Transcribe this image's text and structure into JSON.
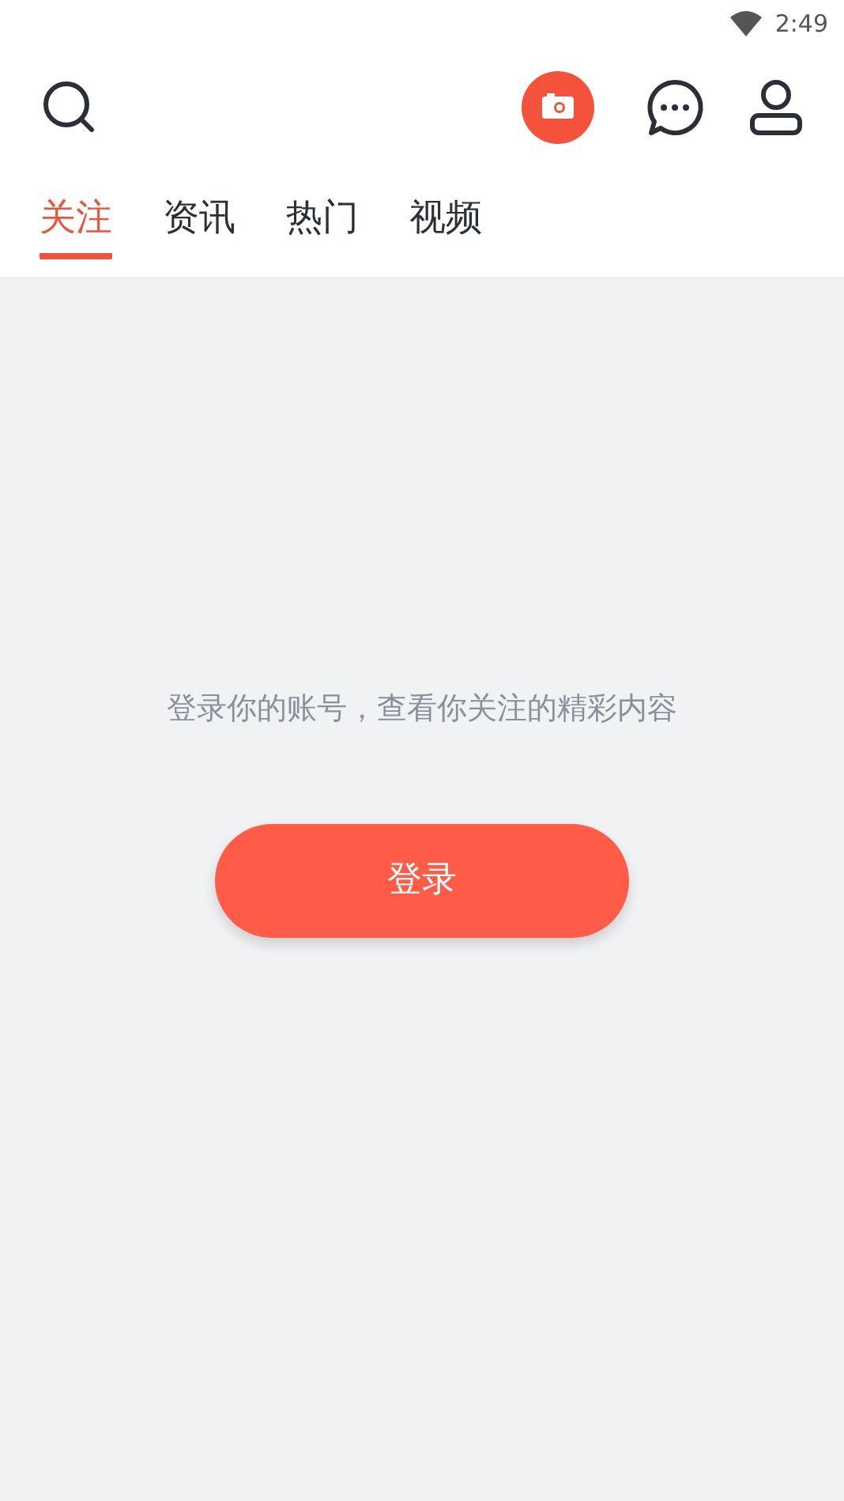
{
  "status_bar": {
    "time": "2:49"
  },
  "tabs": [
    {
      "label": "关注",
      "selected": true
    },
    {
      "label": "资讯",
      "selected": false
    },
    {
      "label": "热门",
      "selected": false
    },
    {
      "label": "视频",
      "selected": false
    }
  ],
  "empty_state": {
    "message": "登录你的账号，查看你关注的精彩内容",
    "button": "登录"
  }
}
